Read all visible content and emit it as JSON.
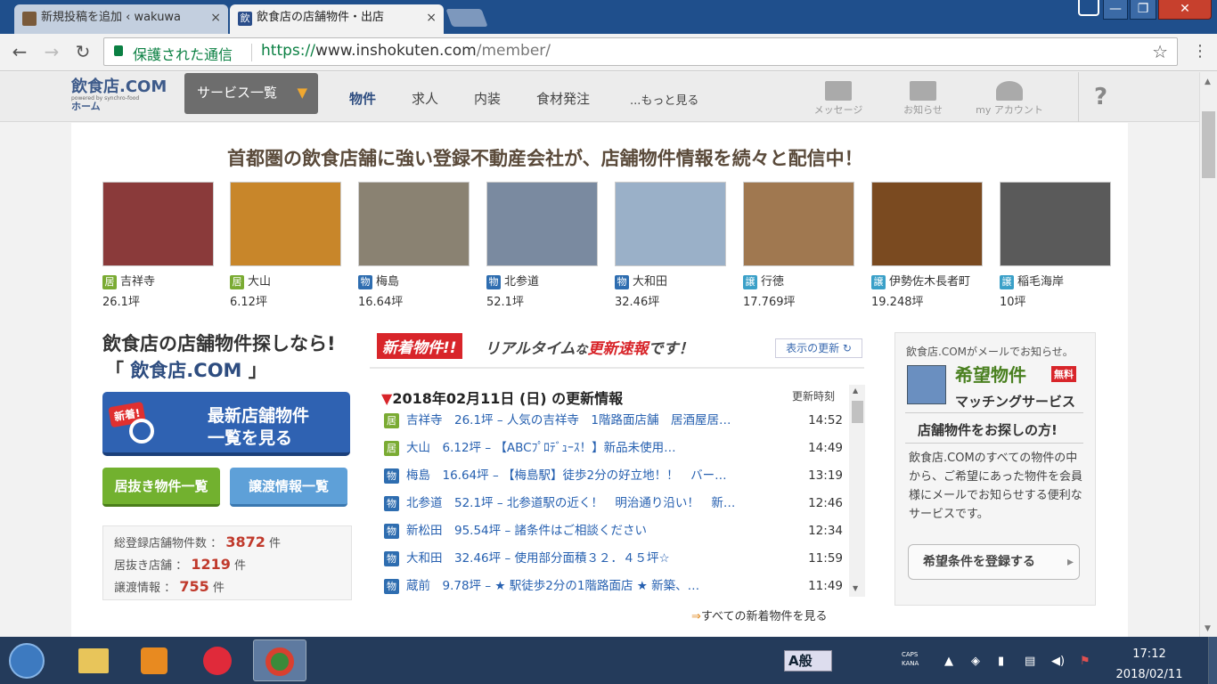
{
  "browser": {
    "tabs": [
      {
        "label": "新規投稿を追加 ‹ wakuwa",
        "close": "×"
      },
      {
        "label": "飲食店の店舗物件・出店",
        "close": "×",
        "favicon": "飲"
      }
    ],
    "window_controls": {
      "minimize": "—",
      "maximize": "❐",
      "close": "✕"
    },
    "nav": {
      "back": "←",
      "forward": "→",
      "reload": "↻"
    },
    "secure_label": "保護された通信",
    "url_scheme": "https://",
    "url_host": "www.inshokuten.com",
    "url_path": "/member/",
    "star": "☆",
    "menu": "⋮"
  },
  "site_header": {
    "logo_text": "飲食店.COM",
    "logo_sub": "powered by synchro-food",
    "logo_home": "ホーム",
    "service_menu": "サービス一覧",
    "service_arrow": "▼",
    "nav": [
      "物件",
      "求人",
      "内装",
      "食材発注",
      "...もっと見る"
    ],
    "icons": [
      {
        "label": "メッセージ",
        "icon": "mail-icon"
      },
      {
        "label": "お知らせ",
        "icon": "notice-icon"
      },
      {
        "label": "my アカウント",
        "icon": "account-icon"
      }
    ],
    "help": "?"
  },
  "headline": "首都圏の飲食店舗に強い登録不動産会社が、店舗物件情報を続々と配信中！",
  "thumbnails": [
    {
      "tag": "居",
      "tag_type": "kyo",
      "place": "吉祥寺",
      "size": "26.1坪",
      "color": "#8a3a3a"
    },
    {
      "tag": "居",
      "tag_type": "kyo",
      "place": "大山",
      "size": "6.12坪",
      "color": "#c8862a"
    },
    {
      "tag": "物",
      "tag_type": "bu",
      "place": "梅島",
      "size": "16.64坪",
      "color": "#8a8272"
    },
    {
      "tag": "物",
      "tag_type": "bu",
      "place": "北参道",
      "size": "52.1坪",
      "color": "#7a8aa0"
    },
    {
      "tag": "物",
      "tag_type": "bu",
      "place": "大和田",
      "size": "32.46坪",
      "color": "#9ab0c8"
    },
    {
      "tag": "譲",
      "tag_type": "jo",
      "place": "行徳",
      "size": "17.769坪",
      "color": "#a07850"
    },
    {
      "tag": "譲",
      "tag_type": "jo",
      "place": "伊勢佐木長者町",
      "size": "19.248坪",
      "color": "#7a4a20"
    },
    {
      "tag": "譲",
      "tag_type": "jo",
      "place": "稲毛海岸",
      "size": "10坪",
      "color": "#5a5a5a"
    }
  ],
  "left": {
    "title1": "飲食店の店舗物件探しなら!",
    "title2_open": "「",
    "title2_brand": "飲食店.COM",
    "title2_close": "」",
    "big_button_badge": "新着!",
    "big_button_line1": "最新店舗物件",
    "big_button_line2": "一覧を見る",
    "green_button": "居抜き物件一覧",
    "blue_button": "譲渡情報一覧",
    "stats": [
      {
        "label": "総登録店舗物件数",
        "sep": "：",
        "value": "3872",
        "unit": "件"
      },
      {
        "label": "居抜き店舗",
        "sep": "：",
        "value": "1219",
        "unit": "件"
      },
      {
        "label": "譲渡情報",
        "sep": "：",
        "value": "755",
        "unit": "件"
      }
    ]
  },
  "middle": {
    "badge": "新着物件!!",
    "realtime_1": "リアルタイム",
    "realtime_2": "な",
    "realtime_3": "更新速報",
    "realtime_4": "です！",
    "refresh": "表示の更新 ↻",
    "update_title": "2018年02月11日 (日) の更新情報",
    "update_marker": "▼",
    "time_header": "更新時刻",
    "rows": [
      {
        "tag": "居",
        "tag_type": "kyo",
        "text": "吉祥寺　26.1坪 – 人気の吉祥寺　1階路面店舗　居酒屋居…",
        "time": "14:52"
      },
      {
        "tag": "居",
        "tag_type": "kyo",
        "text": "大山　6.12坪 – 【ABCﾌﾟﾛﾃﾞｭｰｽ！】新品未使用…",
        "time": "14:49"
      },
      {
        "tag": "物",
        "tag_type": "bu",
        "text": "梅島　16.64坪 – 【梅島駅】徒歩2分の好立地！！　バー…",
        "time": "13:19"
      },
      {
        "tag": "物",
        "tag_type": "bu",
        "text": "北参道　52.1坪 – 北参道駅の近く！　明治通り沿い！　新…",
        "time": "12:46"
      },
      {
        "tag": "物",
        "tag_type": "bu",
        "text": "新松田　95.54坪 – 諸条件はご相談ください",
        "time": "12:34"
      },
      {
        "tag": "物",
        "tag_type": "bu",
        "text": "大和田　32.46坪 – 使用部分面積３２．４５坪☆",
        "time": "11:59"
      },
      {
        "tag": "物",
        "tag_type": "bu",
        "text": "蔵前　9.78坪 – ★ 駅徒歩2分の1階路面店 ★ 新築、…",
        "time": "11:49"
      }
    ],
    "see_all_arrow": "⇒",
    "see_all": "すべての新着物件を見る"
  },
  "right": {
    "notice": "飲食店.COMがメールでお知らせ。",
    "title": "希望物件",
    "free": "無料",
    "subtitle": "マッチングサービス",
    "heading": "店舗物件をお探しの方!",
    "description": "飲食店.COMのすべての物件の中から、ご希望にあった物件を会員様にメールでお知らせする便利なサービスです。",
    "button": "希望条件を登録する",
    "button_arrow": "▸"
  },
  "taskbar": {
    "ime": "A般",
    "caps": "CAPS",
    "kana": "KANA",
    "time": "17:12",
    "date": "2018/02/11"
  }
}
